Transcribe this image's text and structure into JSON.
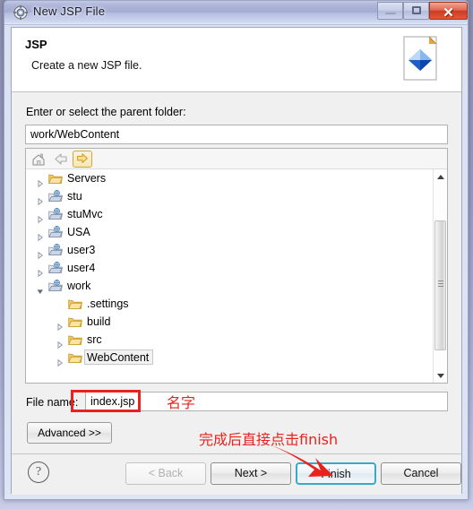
{
  "window": {
    "title": "New JSP File",
    "icon": "eclipse-gear-icon",
    "controls": {
      "minimize": "minimize-button",
      "maximize": "maximize-button",
      "close": "✕"
    }
  },
  "header": {
    "title": "JSP",
    "description": "Create a new JSP file.",
    "icon": "jsp-file-icon"
  },
  "form": {
    "parent_label": "Enter or select the parent folder:",
    "parent_value": "work/WebContent",
    "parent_placeholder": "",
    "filename_label": "File name:",
    "filename_value": "index.jsp",
    "filename_placeholder": "",
    "advanced_label": "Advanced >>"
  },
  "tree": {
    "toolbar": [
      {
        "name": "home-icon",
        "label": "Home"
      },
      {
        "name": "back-arrow-icon",
        "label": "Back"
      },
      {
        "name": "forward-arrow-icon",
        "label": "Forward"
      }
    ],
    "items": [
      {
        "label": "Servers",
        "indent": 0,
        "state": "collapsed",
        "icon": "folder-icon",
        "selected": false
      },
      {
        "label": "stu",
        "indent": 0,
        "state": "collapsed",
        "icon": "web-project-icon",
        "selected": false
      },
      {
        "label": "stuMvc",
        "indent": 0,
        "state": "collapsed",
        "icon": "web-project-icon",
        "selected": false
      },
      {
        "label": "USA",
        "indent": 0,
        "state": "collapsed",
        "icon": "web-project-icon",
        "selected": false
      },
      {
        "label": "user3",
        "indent": 0,
        "state": "collapsed",
        "icon": "web-project-icon",
        "selected": false
      },
      {
        "label": "user4",
        "indent": 0,
        "state": "collapsed",
        "icon": "web-project-icon",
        "selected": false
      },
      {
        "label": "work",
        "indent": 0,
        "state": "expanded",
        "icon": "web-project-icon",
        "selected": false
      },
      {
        "label": ".settings",
        "indent": 1,
        "state": "leaf",
        "icon": "folder-icon",
        "selected": false
      },
      {
        "label": "build",
        "indent": 1,
        "state": "collapsed",
        "icon": "folder-icon",
        "selected": false
      },
      {
        "label": "src",
        "indent": 1,
        "state": "collapsed",
        "icon": "folder-icon",
        "selected": false
      },
      {
        "label": "WebContent",
        "indent": 1,
        "state": "collapsed",
        "icon": "folder-icon",
        "selected": true
      }
    ]
  },
  "buttons": {
    "help": "?",
    "back": "< Back",
    "next": "Next >",
    "finish": "Finish",
    "cancel": "Cancel"
  },
  "annotations": {
    "filename_note": "名字",
    "finish_note": "完成后直接点击finish",
    "color": "#e8231f"
  }
}
